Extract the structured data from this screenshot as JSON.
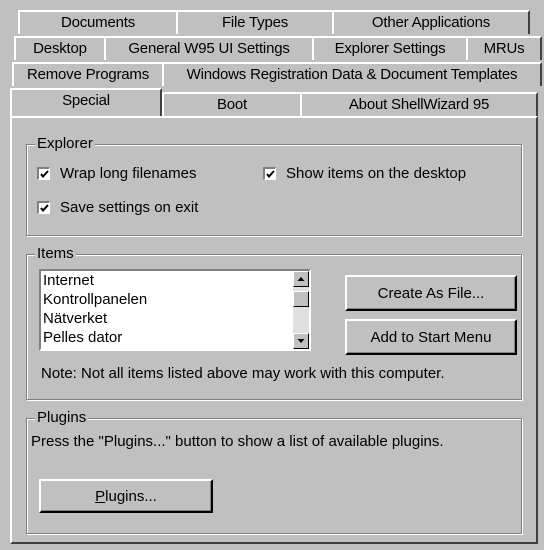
{
  "tabs": {
    "row1": [
      "Documents",
      "File Types",
      "Other Applications"
    ],
    "row2": [
      "Desktop",
      "General W95 UI Settings",
      "Explorer Settings",
      "MRUs"
    ],
    "row3": [
      "Remove Programs",
      "Windows Registration Data & Document Templates"
    ],
    "row4": [
      "Special",
      "Boot",
      "About ShellWizard 95"
    ],
    "active": "Special"
  },
  "explorer": {
    "legend": "Explorer",
    "wrap_long_filenames": {
      "label": "Wrap long filenames",
      "checked": true
    },
    "show_items_desktop": {
      "label": "Show items on the desktop",
      "checked": true
    },
    "save_settings_exit": {
      "label": "Save settings on exit",
      "checked": true
    }
  },
  "items": {
    "legend": "Items",
    "list": [
      "Internet",
      "Kontrollpanelen",
      "Nätverket",
      "Pelles dator"
    ],
    "create_as_file_button": "Create As File...",
    "add_to_start_menu_button": "Add to Start Menu",
    "note": "Note: Not all items listed above may work with this computer."
  },
  "plugins": {
    "legend": "Plugins",
    "description": "Press the \"Plugins...\" button to show a list of available plugins.",
    "button_mnemonic": "P",
    "button_rest": "lugins..."
  }
}
